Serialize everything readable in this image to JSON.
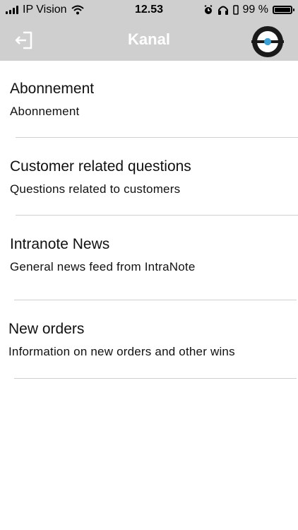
{
  "status_bar": {
    "carrier": "IP Vision",
    "time": "12.53",
    "battery": "99 %",
    "battery_level": 0.99
  },
  "header": {
    "title": "Kanal",
    "logout_icon": "logout-icon",
    "logo_icon": "app-logo"
  },
  "channels": [
    {
      "title": "Abonnement",
      "subtitle": "Abonnement"
    },
    {
      "title": "Customer related questions",
      "subtitle": "Questions related to customers"
    },
    {
      "title": "Intranote News",
      "subtitle": "General news feed from IntraNote"
    },
    {
      "title": "New orders",
      "subtitle": "Information on new orders and other wins"
    }
  ],
  "colors": {
    "header_bg": "#cfcfcf",
    "header_text": "#ffffff",
    "divider": "#d0d0d0",
    "logo_accent": "#3aa0d8"
  }
}
